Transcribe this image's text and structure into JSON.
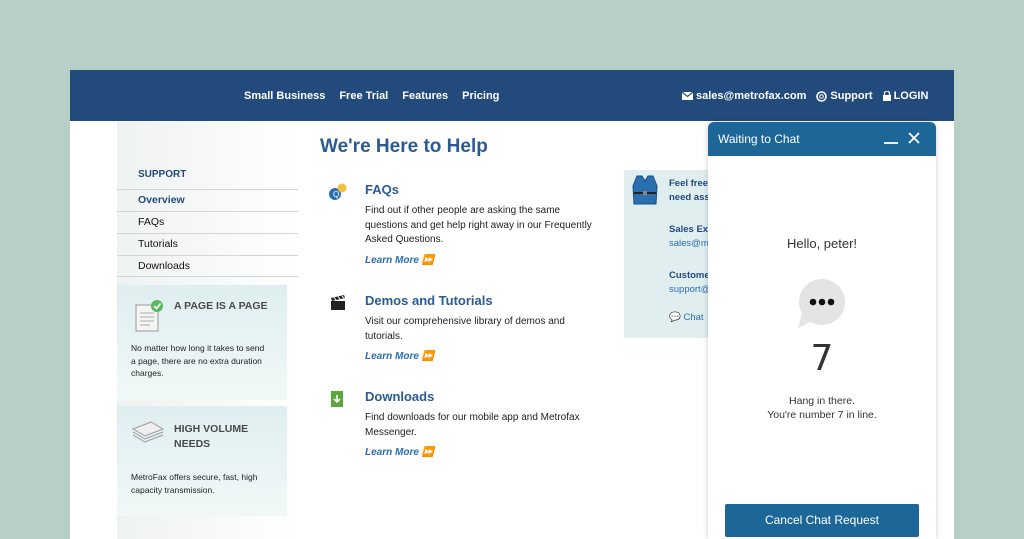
{
  "nav": {
    "links": [
      "Small Business",
      "Free Trial",
      "Features",
      "Pricing"
    ],
    "email": "sales@metrofax.com",
    "support": "Support",
    "login": "LOGIN"
  },
  "sidebar": {
    "heading": "SUPPORT",
    "items": [
      "Overview",
      "FAQs",
      "Tutorials",
      "Downloads"
    ],
    "promo1": {
      "title": "A PAGE IS A PAGE",
      "text": "No matter how long it takes to send a page, there are no extra duration charges."
    },
    "promo2": {
      "title_line1": "HIGH VOLUME",
      "title_line2": "NEEDS",
      "text": "MetroFax offers secure, fast, high capacity transmission."
    }
  },
  "main": {
    "title": "We're Here to Help",
    "sections": [
      {
        "title": "FAQs",
        "desc": "Find out if other people are asking the same questions and get help right away in our Frequently Asked Questions.",
        "link": "Learn More"
      },
      {
        "title": "Demos and Tutorials",
        "desc": "Visit our comprehensive library of demos and tutorials.",
        "link": "Learn More"
      },
      {
        "title": "Downloads",
        "desc": "Find downloads for our mobile app and Metrofax Messenger.",
        "link": "Learn More"
      }
    ]
  },
  "contact": {
    "intro1": "Feel free",
    "intro2": "need ass",
    "sales_label": "Sales Ex",
    "sales_email": "sales@m",
    "customer_label": "Custome",
    "customer_email": "support@",
    "chat_link": "Chat"
  },
  "chat": {
    "header": "Waiting to Chat",
    "greeting": "Hello, peter!",
    "queue_number": "7",
    "line1": "Hang in there.",
    "line2": "You're number 7 in line.",
    "cancel": "Cancel Chat Request"
  },
  "colors": {
    "nav": "#234a7d",
    "chat": "#1c6797",
    "title": "#2a5b95"
  }
}
